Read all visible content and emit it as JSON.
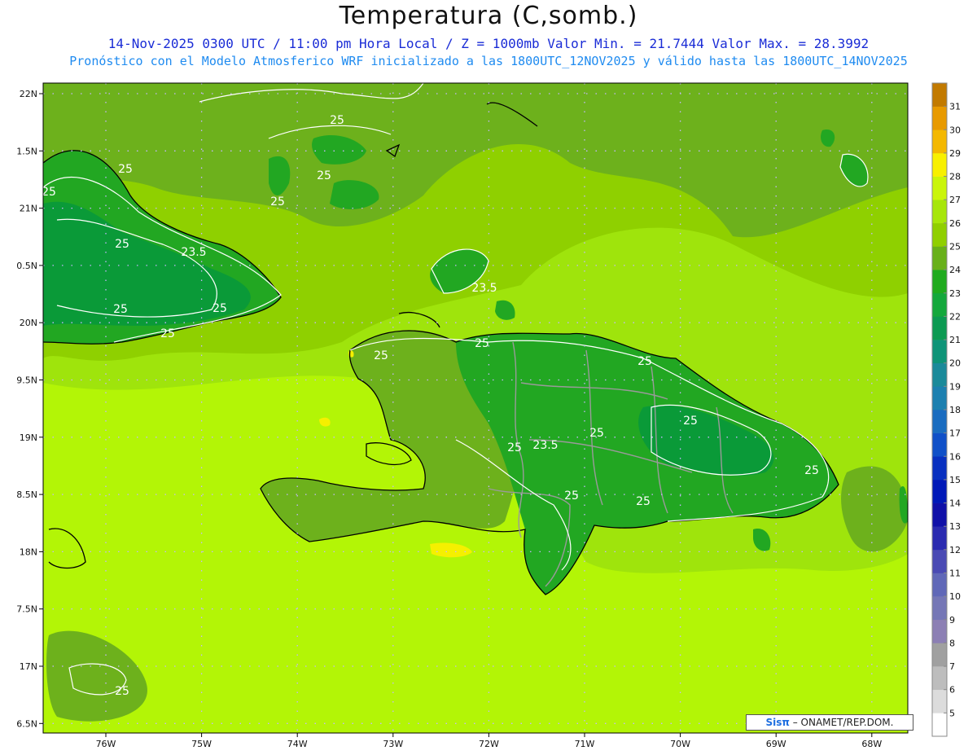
{
  "header": {
    "title": "Temperatura (C,somb.)",
    "line1": "14-Nov-2025 0300 UTC / 11:00 pm Hora Local / Z = 1000mb  Valor Min. = 21.7444  Valor Max. = 28.3992",
    "line2": "Pronóstico con el Modelo Atmosferico WRF inicializado a las 1800UTC_12NOV2025 y válido hasta las  1800UTC_14NOV2025"
  },
  "map": {
    "lat_labels": [
      "22N",
      "1.5N",
      "21N",
      "0.5N",
      "20N",
      "9.5N",
      "19N",
      "8.5N",
      "18N",
      "7.5N",
      "17N",
      "6.5N"
    ],
    "lon_labels": [
      "76W",
      "75W",
      "74W",
      "73W",
      "72W",
      "71W",
      "70W",
      "69W",
      "68W"
    ],
    "contour_labels": [
      "25",
      "25",
      "25",
      "25",
      "25",
      "23.5",
      "25",
      "23.5",
      "25",
      "25",
      "25",
      "25",
      "25",
      "25",
      "25",
      "23.5",
      "25",
      "25",
      "25",
      "25",
      "25",
      "25"
    ],
    "colors": {
      "ocean": "#9fe40c",
      "ocean_light": "#b3f506",
      "band_26": "#8fd000",
      "band_25": "#6db11c",
      "band_24": "#22a722",
      "band_23": "#0a9a38",
      "band_22": "#0b8f45",
      "yellow": "#f5f000",
      "coast": "#000000",
      "provinces": "#9a9a9a",
      "contour": "#ffffff",
      "grid": "#c6b7ff"
    }
  },
  "colorbar": {
    "levels": [
      "5",
      "6",
      "7",
      "8",
      "9",
      "10",
      "11",
      "12",
      "13",
      "14",
      "15",
      "16",
      "17",
      "18",
      "19",
      "20",
      "21",
      "22",
      "23",
      "24",
      "25",
      "26",
      "27",
      "28",
      "29",
      "30",
      "31"
    ],
    "colors": [
      "#ffffff",
      "#dcdcdc",
      "#bdbdbd",
      "#a0a0a0",
      "#8c7fb4",
      "#7577b6",
      "#6068b8",
      "#4a4ab4",
      "#2a2ab0",
      "#1010a8",
      "#0018b8",
      "#0830c0",
      "#1050c8",
      "#1a6cc0",
      "#1c80b0",
      "#1a8a9a",
      "#0e9478",
      "#0c9a52",
      "#14a83c",
      "#20ab1e",
      "#68b01a",
      "#90cf00",
      "#a7e60a",
      "#caf50a",
      "#f8f000",
      "#f4b800",
      "#e89a00",
      "#c27a00"
    ]
  },
  "footer": {
    "brand": "Sisπ",
    "credit": " – ONAMET/REP.DOM."
  }
}
